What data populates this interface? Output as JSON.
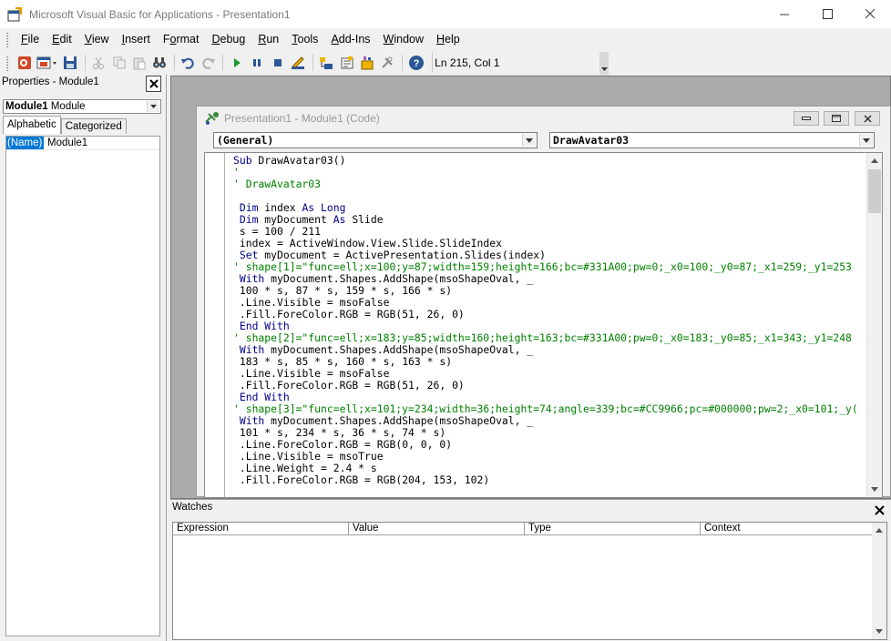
{
  "window": {
    "title": "Microsoft Visual Basic for Applications - Presentation1"
  },
  "menu": [
    {
      "label": "File",
      "key": "F"
    },
    {
      "label": "Edit",
      "key": "E"
    },
    {
      "label": "View",
      "key": "V"
    },
    {
      "label": "Insert",
      "key": "I"
    },
    {
      "label": "Format",
      "key": "o"
    },
    {
      "label": "Debug",
      "key": "D"
    },
    {
      "label": "Run",
      "key": "R"
    },
    {
      "label": "Tools",
      "key": "T"
    },
    {
      "label": "Add-Ins",
      "key": "A"
    },
    {
      "label": "Window",
      "key": "W"
    },
    {
      "label": "Help",
      "key": "H"
    }
  ],
  "toolbar": {
    "status": "Ln 215, Col 1"
  },
  "properties": {
    "title": "Properties - Module1",
    "object_name": "Module1",
    "object_type": "Module",
    "tab_alphabetic": "Alphabetic",
    "tab_categorized": "Categorized",
    "rows": [
      {
        "name": "(Name)",
        "value": "Module1"
      }
    ]
  },
  "code_window": {
    "title": "Presentation1 - Module1 (Code)",
    "object_combo": "(General)",
    "proc_combo": "DrawAvatar03",
    "lines": [
      {
        "text": "Sub DrawAvatar03()",
        "type": "code"
      },
      {
        "text": "'",
        "type": "comment"
      },
      {
        "text": "' DrawAvatar03",
        "type": "comment"
      },
      {
        "text": "",
        "type": "code"
      },
      {
        "text": " Dim index As Long",
        "type": "code"
      },
      {
        "text": " Dim myDocument As Slide",
        "type": "code"
      },
      {
        "text": " s = 100 / 211",
        "type": "code"
      },
      {
        "text": " index = ActiveWindow.View.Slide.SlideIndex",
        "type": "code"
      },
      {
        "text": " Set myDocument = ActivePresentation.Slides(index)",
        "type": "code"
      },
      {
        "text": "' shape[1]=\"func=ell;x=100;y=87;width=159;height=166;bc=#331A00;pw=0;_x0=100;_y0=87;_x1=259;_y1=253",
        "type": "comment"
      },
      {
        "text": " With myDocument.Shapes.AddShape(msoShapeOval, _",
        "type": "code"
      },
      {
        "text": " 100 * s, 87 * s, 159 * s, 166 * s)",
        "type": "code"
      },
      {
        "text": " .Line.Visible = msoFalse",
        "type": "code"
      },
      {
        "text": " .Fill.ForeColor.RGB = RGB(51, 26, 0)",
        "type": "code"
      },
      {
        "text": " End With",
        "type": "code"
      },
      {
        "text": "' shape[2]=\"func=ell;x=183;y=85;width=160;height=163;bc=#331A00;pw=0;_x0=183;_y0=85;_x1=343;_y1=248",
        "type": "comment"
      },
      {
        "text": " With myDocument.Shapes.AddShape(msoShapeOval, _",
        "type": "code"
      },
      {
        "text": " 183 * s, 85 * s, 160 * s, 163 * s)",
        "type": "code"
      },
      {
        "text": " .Line.Visible = msoFalse",
        "type": "code"
      },
      {
        "text": " .Fill.ForeColor.RGB = RGB(51, 26, 0)",
        "type": "code"
      },
      {
        "text": " End With",
        "type": "code"
      },
      {
        "text": "' shape[3]=\"func=ell;x=101;y=234;width=36;height=74;angle=339;bc=#CC9966;pc=#000000;pw=2;_x0=101;_y(",
        "type": "comment"
      },
      {
        "text": " With myDocument.Shapes.AddShape(msoShapeOval, _",
        "type": "code"
      },
      {
        "text": " 101 * s, 234 * s, 36 * s, 74 * s)",
        "type": "code"
      },
      {
        "text": " .Line.ForeColor.RGB = RGB(0, 0, 0)",
        "type": "code"
      },
      {
        "text": " .Line.Visible = msoTrue",
        "type": "code"
      },
      {
        "text": " .Line.Weight = 2.4 * s",
        "type": "code"
      },
      {
        "text": " .Fill.ForeColor.RGB = RGB(204, 153, 102)",
        "type": "code"
      }
    ]
  },
  "watches": {
    "title": "Watches",
    "columns": [
      "Expression",
      "Value",
      "Type",
      "Context"
    ]
  },
  "colors": {
    "comment": "#008000",
    "keyword": "#00008b",
    "selection": "#0078d7"
  }
}
